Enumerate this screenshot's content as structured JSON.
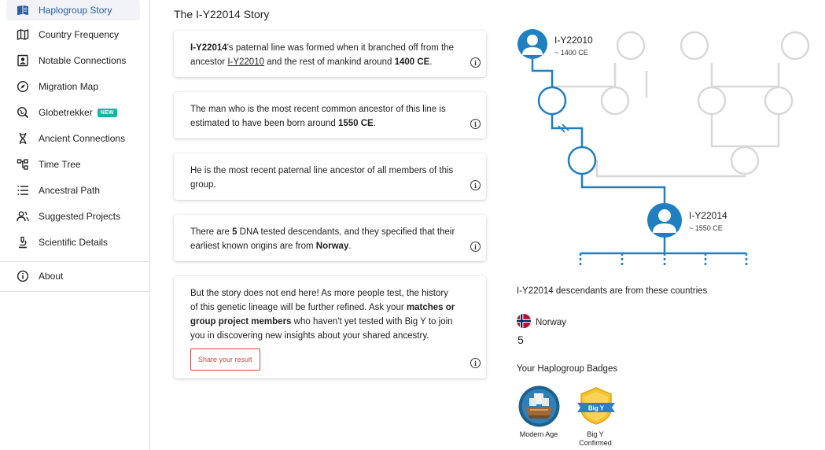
{
  "sidebar": {
    "items": [
      {
        "label": "Haplogroup Story",
        "icon": "book-icon",
        "active": true
      },
      {
        "label": "Country Frequency",
        "icon": "map-icon"
      },
      {
        "label": "Notable Connections",
        "icon": "portrait-icon"
      },
      {
        "label": "Migration Map",
        "icon": "compass-icon"
      },
      {
        "label": "Globetrekker",
        "icon": "globe-search-icon",
        "badge": "NEW"
      },
      {
        "label": "Ancient Connections",
        "icon": "dna-icon"
      },
      {
        "label": "Time Tree",
        "icon": "tree-structure-icon"
      },
      {
        "label": "Ancestral Path",
        "icon": "list-icon"
      },
      {
        "label": "Suggested Projects",
        "icon": "group-icon"
      },
      {
        "label": "Scientific Details",
        "icon": "microscope-icon"
      }
    ],
    "about": {
      "label": "About",
      "icon": "info-icon"
    }
  },
  "main": {
    "title": "The I-Y22014 Story",
    "cards": [
      {
        "parts": [
          "I-Y22014",
          "'s paternal line was formed when it branched off from the ancestor ",
          "I-Y22010",
          " and the rest of mankind around ",
          "1400 CE",
          "."
        ]
      },
      {
        "parts": [
          "The man who is the most recent common ancestor of this line is estimated to have been born around ",
          "1550 CE",
          "."
        ]
      },
      {
        "parts": [
          "He is the most recent paternal line ancestor of all members of this group."
        ]
      },
      {
        "parts": [
          "There are ",
          "5",
          " DNA tested descendants, and they specified that their earliest known origins are from ",
          "Norway",
          "."
        ]
      },
      {
        "parts": [
          "But the story does not end here! As more people test, the history of this genetic lineage will be further refined. Ask your ",
          "matches or group project members",
          " who haven't yet tested with Big Y to join you in discovering new insights about your shared ancestry."
        ],
        "button": "Share your result"
      }
    ]
  },
  "tree": {
    "ancestor": {
      "name": "I-Y22010",
      "date": "~ 1400 CE"
    },
    "current": {
      "name": "I-Y22014",
      "date": "~ 1550 CE"
    },
    "line_color": "#1f7fc0",
    "gray_color": "#d8d8d8"
  },
  "countries": {
    "title_haplogroup": "I-Y22014",
    "title_rest": " descendants are from these countries",
    "items": [
      {
        "name": "Norway",
        "count": "5"
      }
    ]
  },
  "badges": {
    "title": "Your Haplogroup Badges",
    "items": [
      {
        "label": "Modern Age"
      },
      {
        "label_line1": "Big Y",
        "label_line2": "Confirmed",
        "emblem": "Big Y"
      }
    ]
  },
  "colors": {
    "accent": "#2b5ea7",
    "share": "#d0473a",
    "new_badge": "#15b5a5"
  }
}
